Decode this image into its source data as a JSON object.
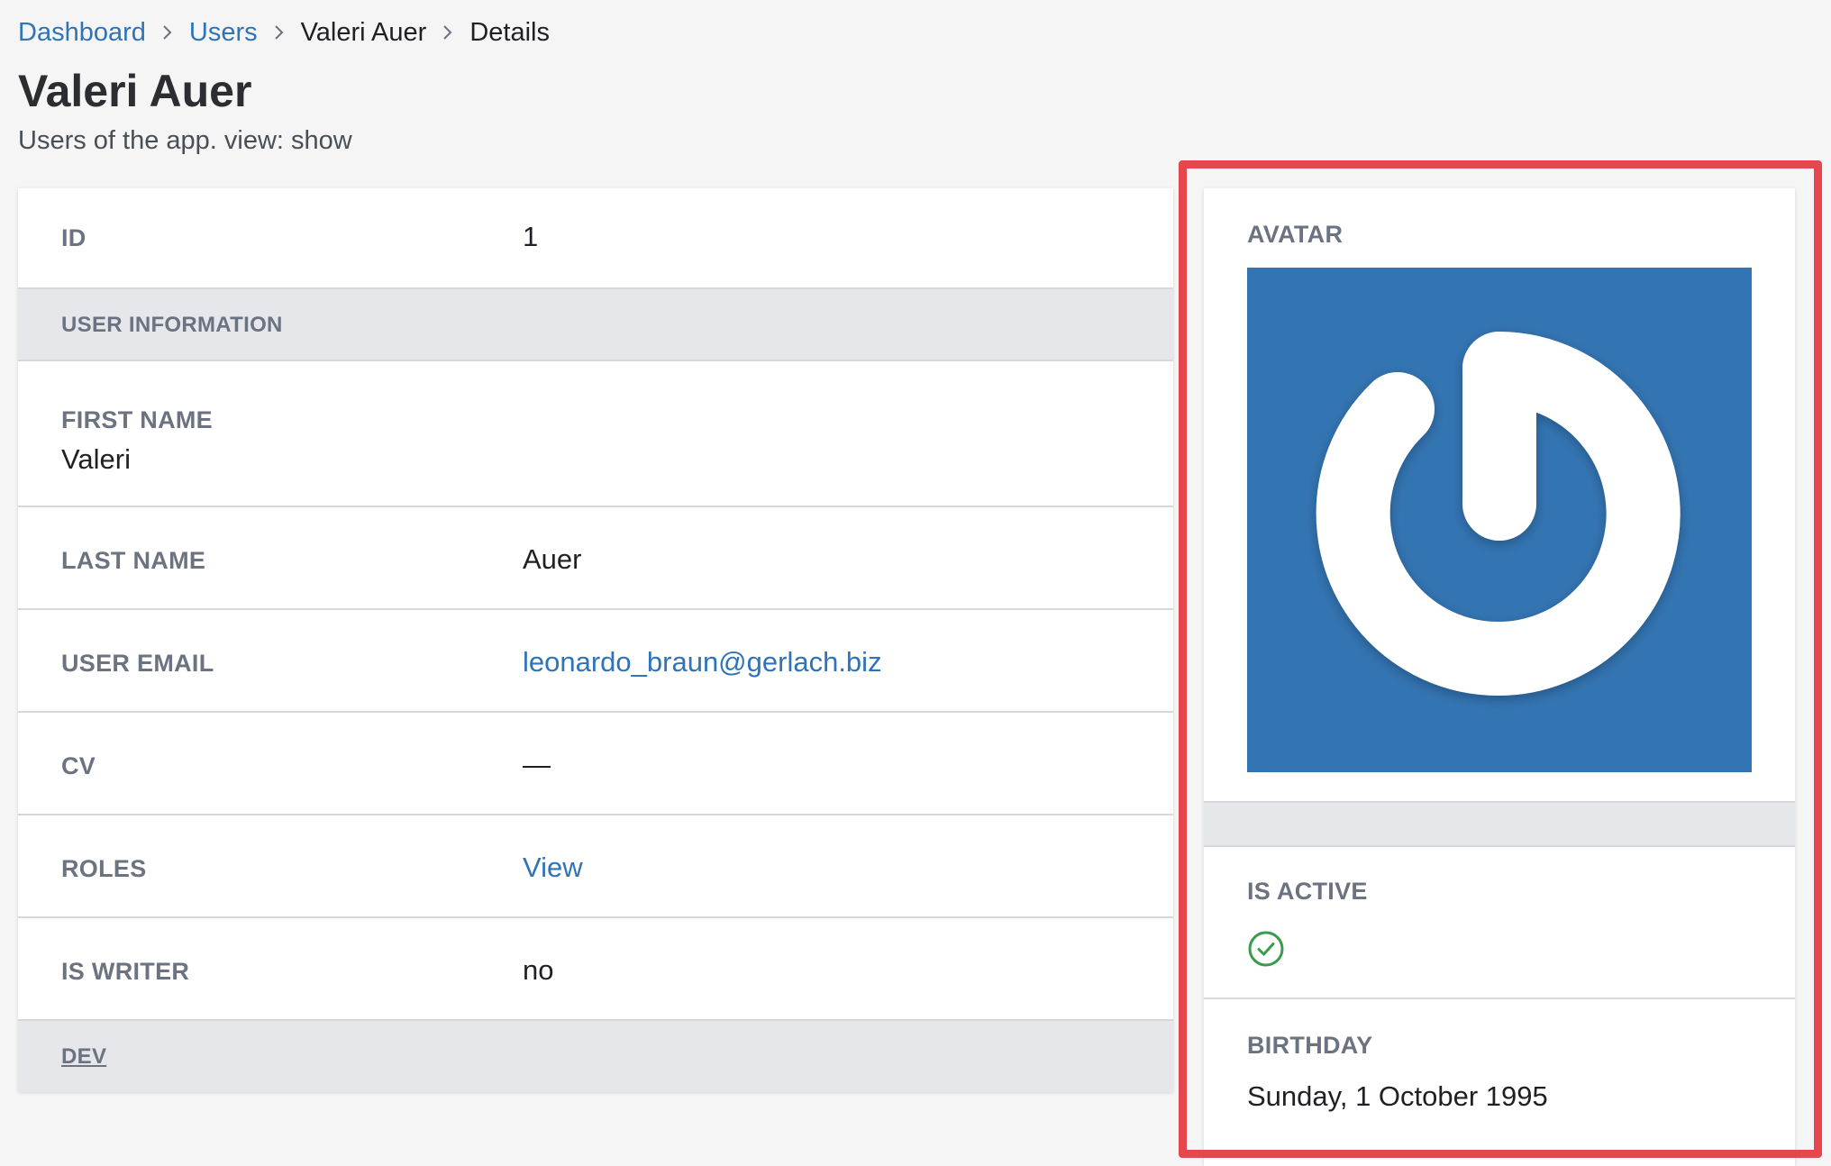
{
  "breadcrumb": {
    "items": [
      {
        "label": "Dashboard"
      },
      {
        "label": "Users"
      },
      {
        "label": "Valeri Auer"
      },
      {
        "label": "Details"
      }
    ]
  },
  "page": {
    "title": "Valeri Auer",
    "subtitle": "Users of the app. view: show"
  },
  "details": {
    "id": {
      "label": "ID",
      "value": "1"
    },
    "user_information_section": "USER INFORMATION",
    "first_name": {
      "label": "FIRST NAME",
      "value": "Valeri"
    },
    "last_name": {
      "label": "LAST NAME",
      "value": "Auer"
    },
    "user_email": {
      "label": "USER EMAIL",
      "value": "leonardo_braun@gerlach.biz"
    },
    "cv": {
      "label": "CV",
      "value": "—"
    },
    "roles": {
      "label": "ROLES",
      "value": "View"
    },
    "is_writer": {
      "label": "IS WRITER",
      "value": "no"
    },
    "dev_section": "DEV"
  },
  "sidebar": {
    "avatar_label": "AVATAR",
    "avatar_icon": "power-logo-icon",
    "is_active": {
      "label": "IS ACTIVE",
      "value_icon": "check-circle-icon",
      "value": true
    },
    "birthday": {
      "label": "BIRTHDAY",
      "value": "Sunday, 1 October 1995"
    }
  },
  "colors": {
    "link": "#2f73b9",
    "highlight_border": "#e5474d",
    "avatar_background": "#3374b2",
    "success": "#3a9b4b",
    "section_background": "#e5e7eb"
  }
}
